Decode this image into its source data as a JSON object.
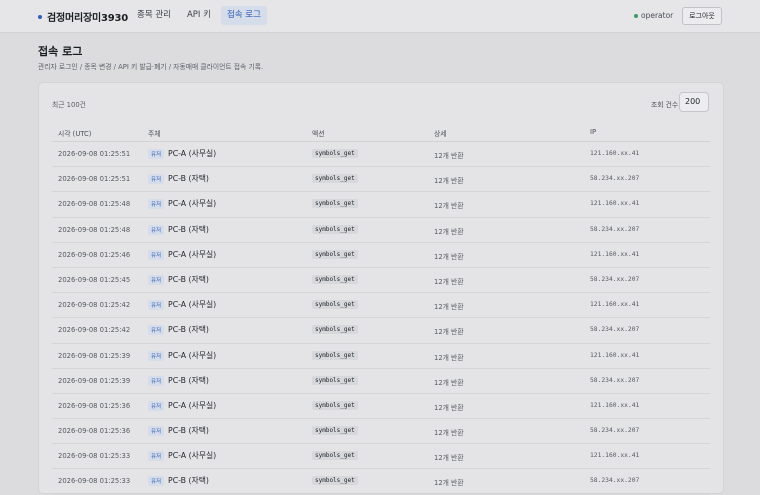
{
  "header": {
    "brand": "검정머리장미3930",
    "tabs": [
      {
        "label": "종목 관리"
      },
      {
        "label": "API 키"
      },
      {
        "label": "접속 로그",
        "active": true
      }
    ],
    "user": "operator",
    "logout_label": "로그아웃"
  },
  "page": {
    "title": "접속 로그",
    "description": "관리자 로그인 / 종목 변경 / API 키 발급·폐기 / 자동매매 클라이언트 접속 기록."
  },
  "card": {
    "recent_label": "최근 100건",
    "count_label": "조회 건수",
    "count_value": "200"
  },
  "table": {
    "columns": [
      "시각 (UTC)",
      "주체",
      "액션",
      "상세",
      "IP"
    ],
    "rows": [
      {
        "time": "2026-09-08 01:25:51",
        "badge": "유저",
        "subject": "PC-A (사무실)",
        "action": "symbols_get",
        "detail": "12개 반환",
        "ip": "121.160.xx.41"
      },
      {
        "time": "2026-09-08 01:25:51",
        "badge": "유저",
        "subject": "PC-B (자택)",
        "action": "symbols_get",
        "detail": "12개 반환",
        "ip": "58.234.xx.207"
      },
      {
        "time": "2026-09-08 01:25:48",
        "badge": "유저",
        "subject": "PC-A (사무실)",
        "action": "symbols_get",
        "detail": "12개 반환",
        "ip": "121.160.xx.41"
      },
      {
        "time": "2026-09-08 01:25:48",
        "badge": "유저",
        "subject": "PC-B (자택)",
        "action": "symbols_get",
        "detail": "12개 반환",
        "ip": "58.234.xx.207"
      },
      {
        "time": "2026-09-08 01:25:46",
        "badge": "유저",
        "subject": "PC-A (사무실)",
        "action": "symbols_get",
        "detail": "12개 반환",
        "ip": "121.160.xx.41"
      },
      {
        "time": "2026-09-08 01:25:45",
        "badge": "유저",
        "subject": "PC-B (자택)",
        "action": "symbols_get",
        "detail": "12개 반환",
        "ip": "58.234.xx.207"
      },
      {
        "time": "2026-09-08 01:25:42",
        "badge": "유저",
        "subject": "PC-A (사무실)",
        "action": "symbols_get",
        "detail": "12개 반환",
        "ip": "121.160.xx.41"
      },
      {
        "time": "2026-09-08 01:25:42",
        "badge": "유저",
        "subject": "PC-B (자택)",
        "action": "symbols_get",
        "detail": "12개 반환",
        "ip": "58.234.xx.207"
      },
      {
        "time": "2026-09-08 01:25:39",
        "badge": "유저",
        "subject": "PC-A (사무실)",
        "action": "symbols_get",
        "detail": "12개 반환",
        "ip": "121.160.xx.41"
      },
      {
        "time": "2026-09-08 01:25:39",
        "badge": "유저",
        "subject": "PC-B (자택)",
        "action": "symbols_get",
        "detail": "12개 반환",
        "ip": "58.234.xx.207"
      },
      {
        "time": "2026-09-08 01:25:36",
        "badge": "유저",
        "subject": "PC-A (사무실)",
        "action": "symbols_get",
        "detail": "12개 반환",
        "ip": "121.160.xx.41"
      },
      {
        "time": "2026-09-08 01:25:36",
        "badge": "유저",
        "subject": "PC-B (자택)",
        "action": "symbols_get",
        "detail": "12개 반환",
        "ip": "58.234.xx.207"
      },
      {
        "time": "2026-09-08 01:25:33",
        "badge": "유저",
        "subject": "PC-A (사무실)",
        "action": "symbols_get",
        "detail": "12개 반환",
        "ip": "121.160.xx.41"
      },
      {
        "time": "2026-09-08 01:25:33",
        "badge": "유저",
        "subject": "PC-B (자택)",
        "action": "symbols_get",
        "detail": "12개 반환",
        "ip": "58.234.xx.207"
      }
    ]
  }
}
